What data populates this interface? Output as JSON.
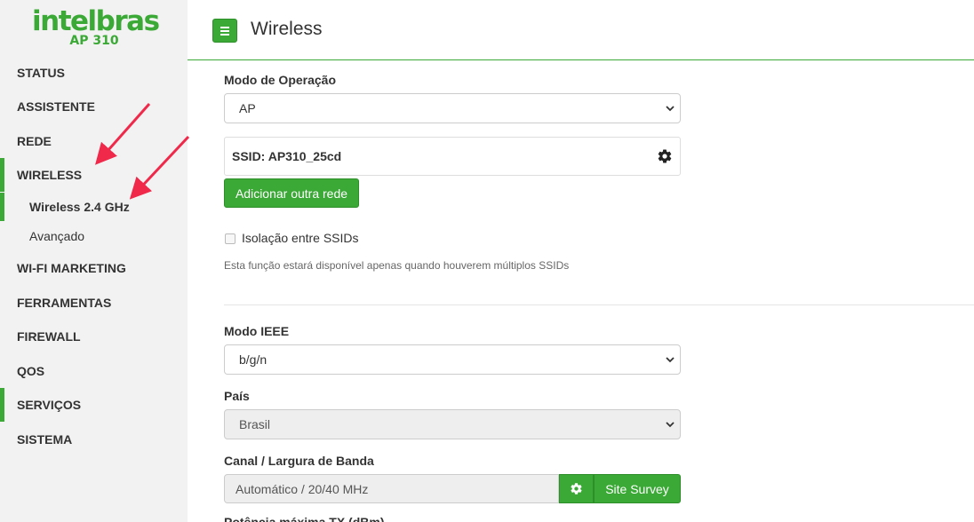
{
  "brand": {
    "name": "intelbras",
    "model": "AP 310",
    "color": "#3aa935"
  },
  "header": {
    "title": "Wireless",
    "menu_icon": "hamburger-icon"
  },
  "sidebar": {
    "items": [
      {
        "label": "STATUS"
      },
      {
        "label": "ASSISTENTE"
      },
      {
        "label": "REDE"
      },
      {
        "label": "WIRELESS"
      },
      {
        "label": "WI-FI MARKETING"
      },
      {
        "label": "FERRAMENTAS"
      },
      {
        "label": "FIREWALL"
      },
      {
        "label": "QOS"
      },
      {
        "label": "SERVIÇOS"
      },
      {
        "label": "SISTEMA"
      }
    ],
    "wireless_sub": [
      {
        "label": "Wireless 2.4 GHz",
        "active": true
      },
      {
        "label": "Avançado",
        "active": false
      }
    ]
  },
  "form": {
    "mode": {
      "label": "Modo de Operação",
      "value": "AP"
    },
    "ssid": {
      "text": "SSID: AP310_25cd",
      "icon": "gear-icon"
    },
    "add_network_button": "Adicionar outra rede",
    "isolation": {
      "label": "Isolação entre SSIDs",
      "checked": false,
      "help": "Esta função estará disponível apenas quando houverem múltiplos SSIDs"
    },
    "ieee": {
      "label": "Modo IEEE",
      "value": "b/g/n"
    },
    "country": {
      "label": "País",
      "value": "Brasil"
    },
    "channel": {
      "label": "Canal / Largura de Banda",
      "value": "Automático / 20/40 MHz",
      "gear_icon": "gear-icon",
      "site_survey_button": "Site Survey"
    },
    "tx_power_label": "Potência máxima TX (dBm)"
  },
  "colors": {
    "accent": "#3aa935",
    "arrow": "#f0284a"
  }
}
